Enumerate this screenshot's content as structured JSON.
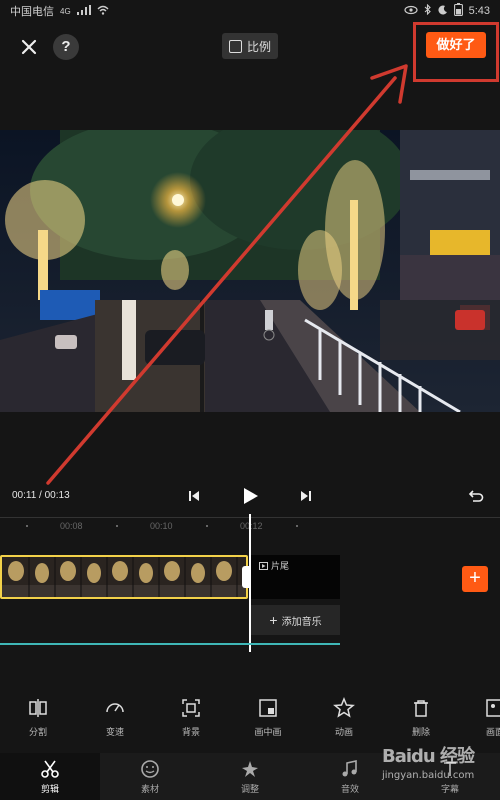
{
  "status_bar": {
    "carrier": "中国电信",
    "network": "4G",
    "time": "5:43"
  },
  "top_bar": {
    "close_icon": "close-icon",
    "help_label": "?",
    "ratio_label": "比例",
    "done_label": "做好了"
  },
  "playback": {
    "time_readout": "00:11 / 00:13",
    "prev_icon": "skip-previous-icon",
    "play_icon": "play-icon",
    "next_icon": "skip-next-icon",
    "undo_icon": "undo-icon"
  },
  "ruler": {
    "ticks": [
      "00:08",
      "00:10",
      "00:12"
    ]
  },
  "timeline": {
    "ending_label": "片尾",
    "add_music_label": "添加音乐",
    "add_clip_label": "+"
  },
  "tools": [
    {
      "label": "分割",
      "icon": "split-icon"
    },
    {
      "label": "变速",
      "icon": "speed-icon"
    },
    {
      "label": "背景",
      "icon": "background-icon"
    },
    {
      "label": "画中画",
      "icon": "picture-in-picture-icon"
    },
    {
      "label": "动画",
      "icon": "animation-icon"
    },
    {
      "label": "删除",
      "icon": "trash-icon"
    },
    {
      "label": "画面",
      "icon": "frame-icon"
    }
  ],
  "tabs": [
    {
      "label": "剪辑",
      "icon": "scissors-icon",
      "active": true
    },
    {
      "label": "素材",
      "icon": "sticker-icon",
      "active": false
    },
    {
      "label": "调整",
      "icon": "adjust-icon",
      "active": false
    },
    {
      "label": "音效",
      "icon": "music-icon",
      "active": false
    },
    {
      "label": "字幕",
      "icon": "text-icon",
      "active": false
    }
  ],
  "watermark": {
    "brand": "Baidu 经验",
    "site": "jingyan.baidu.com"
  },
  "colors": {
    "accent": "#ff5a14",
    "clip_border": "#f3d24a",
    "annotation": "#d03a2f",
    "audio_line": "#3fb7b7"
  }
}
